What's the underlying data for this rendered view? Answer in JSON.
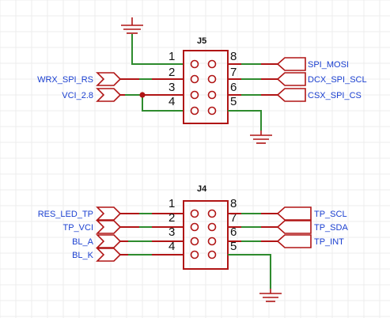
{
  "colors": {
    "wire": "#2e8b2e",
    "component": "#b01515",
    "net_label": "#1a3fd0",
    "junction": "#b01515",
    "grid": "#ececec"
  },
  "connectors": [
    {
      "ref": "J5",
      "pins_left": [
        "1",
        "2",
        "3",
        "4"
      ],
      "pins_right": [
        "8",
        "7",
        "6",
        "5"
      ],
      "labels_left": [
        "WRX_SPI_RS",
        "VCI_2.8"
      ],
      "labels_right": [
        "SPI_MOSI",
        "DCX_SPI_SCL",
        "CSX_SPI_CS"
      ]
    },
    {
      "ref": "J4",
      "pins_left": [
        "1",
        "2",
        "3",
        "4"
      ],
      "pins_right": [
        "8",
        "7",
        "6",
        "5"
      ],
      "labels_left": [
        "RES_LED_TP",
        "TP_VCI",
        "BL_A",
        "BL_K"
      ],
      "labels_right": [
        "TP_SCL",
        "TP_SDA",
        "TP_INT"
      ]
    }
  ]
}
